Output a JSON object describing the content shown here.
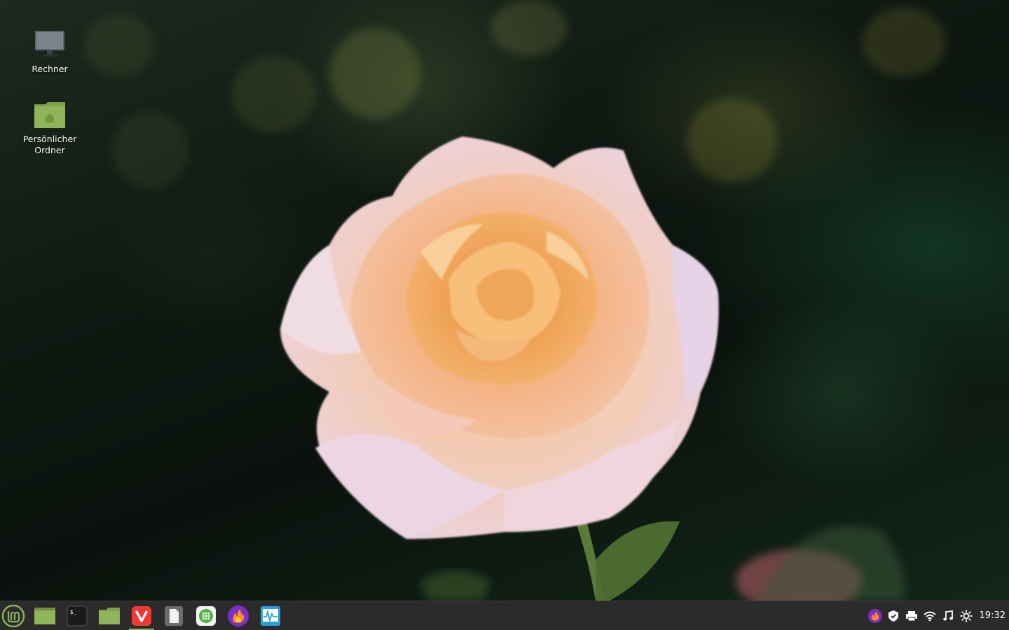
{
  "desktop": {
    "wallpaper": "rose-wallpaper",
    "icons": [
      {
        "label": "Rechner",
        "icon": "computer-icon"
      },
      {
        "label": "Persönlicher\nOrdner",
        "icon": "home-folder-icon"
      }
    ]
  },
  "panel": {
    "menu": {
      "icon": "linux-mint-menu-icon"
    },
    "launchers": [
      {
        "icon": "show-desktop-icon"
      },
      {
        "icon": "terminal-icon"
      },
      {
        "icon": "files-icon"
      },
      {
        "icon": "vivaldi-icon",
        "active": true
      },
      {
        "icon": "text-editor-icon"
      },
      {
        "icon": "spreadsheet-icon"
      },
      {
        "icon": "firefox-dev-icon"
      },
      {
        "icon": "system-monitor-icon"
      }
    ],
    "tray": [
      {
        "icon": "firefox-tray-icon"
      },
      {
        "icon": "shield-icon"
      },
      {
        "icon": "printer-icon"
      },
      {
        "icon": "wifi-icon"
      },
      {
        "icon": "music-note-icon"
      },
      {
        "icon": "brightness-icon"
      }
    ],
    "clock": "19:32"
  },
  "colors": {
    "panel_bg": "#2b2b2b",
    "mint_green": "#8bb158",
    "vivaldi_red": "#ef3939",
    "folder_green": "#8fb459"
  }
}
